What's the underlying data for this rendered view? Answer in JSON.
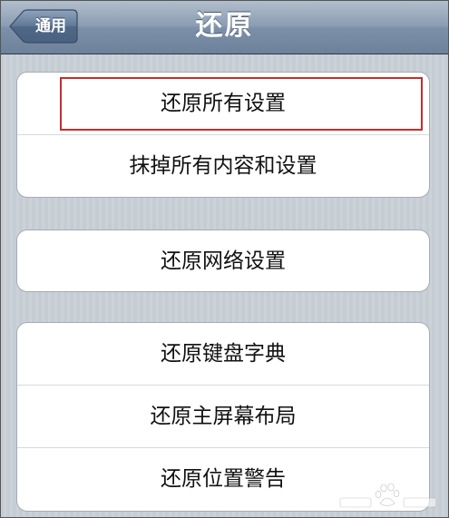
{
  "navbar": {
    "title": "还原",
    "back_label": "通用"
  },
  "groups": [
    {
      "items": [
        {
          "label": "还原所有设置"
        },
        {
          "label": "抹掉所有内容和设置"
        }
      ]
    },
    {
      "items": [
        {
          "label": "还原网络设置"
        }
      ]
    },
    {
      "items": [
        {
          "label": "还原键盘字典"
        },
        {
          "label": "还原主屏幕布局"
        },
        {
          "label": "还原位置警告"
        }
      ]
    }
  ],
  "colors": {
    "highlight": "#c62d2d",
    "navbar": "#8b9db3",
    "background": "#c5ccd4"
  },
  "icons": {
    "back": "back-arrow-icon",
    "watermark": "baidu-watermark-icon"
  }
}
